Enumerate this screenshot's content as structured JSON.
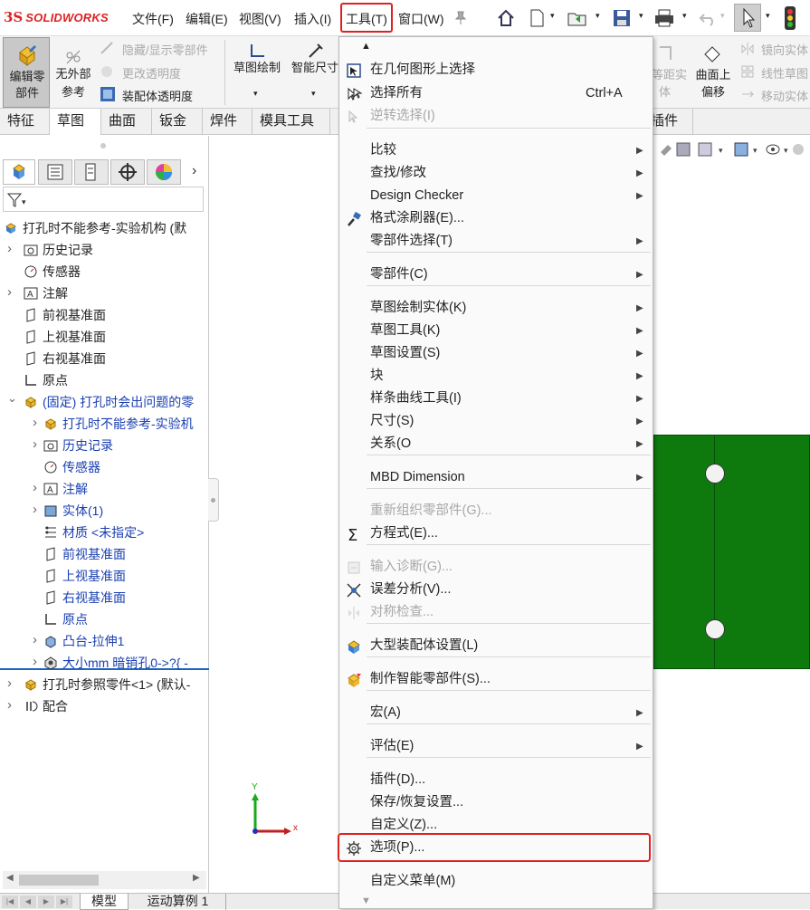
{
  "app": {
    "logo_prefix": "3S",
    "logo_name": "SOLIDWORKS"
  },
  "menubar": {
    "items": [
      "文件(F)",
      "编辑(E)",
      "视图(V)",
      "插入(I)",
      "工具(T)",
      "窗口(W)"
    ]
  },
  "ribbon": {
    "edit_component": "编辑零\n部件",
    "edit_component_l1": "编辑零",
    "edit_component_l2": "部件",
    "no_external_l1": "无外部",
    "no_external_l2": "参考",
    "hide_show": "隐藏/显示零部件",
    "change_transparency": "更改透明度",
    "assembly_transparency": "装配体透明度",
    "sketch": "草图绘制",
    "smart_dim": "智能尺寸",
    "equal_dist_l1": "等距实",
    "equal_dist_l2": "体",
    "offset_surface_l1": "曲面上",
    "offset_surface_l2": "偏移",
    "mirror_entity": "镜向实体",
    "linear_pattern": "线性草图",
    "move_entity": "移动实体"
  },
  "command_tabs": [
    "特征",
    "草图",
    "曲面",
    "钣金",
    "焊件",
    "模具工具",
    "插件"
  ],
  "feature_tree": {
    "filter_icon": "funnel-icon",
    "rows": [
      {
        "label": "打孔时不能参考-实验机构 (默",
        "level": 0,
        "arrow": false,
        "color": "normal"
      },
      {
        "label": "历史记录",
        "level": 1,
        "arrow": true,
        "color": "normal"
      },
      {
        "label": "传感器",
        "level": 1,
        "arrow": false,
        "color": "normal"
      },
      {
        "label": "注解",
        "level": 1,
        "arrow": true,
        "color": "normal"
      },
      {
        "label": "前视基准面",
        "level": 1,
        "arrow": false,
        "color": "normal"
      },
      {
        "label": "上视基准面",
        "level": 1,
        "arrow": false,
        "color": "normal"
      },
      {
        "label": "右视基准面",
        "level": 1,
        "arrow": false,
        "color": "normal"
      },
      {
        "label": "原点",
        "level": 1,
        "arrow": false,
        "color": "normal"
      },
      {
        "label": "(固定) 打孔时会出问题的零",
        "level": 1,
        "arrow": "open",
        "color": "blue"
      },
      {
        "label": "打孔时不能参考-实验机",
        "level": 2,
        "arrow": true,
        "color": "blue"
      },
      {
        "label": "历史记录",
        "level": 2,
        "arrow": true,
        "color": "blue"
      },
      {
        "label": "传感器",
        "level": 2,
        "arrow": false,
        "color": "blue"
      },
      {
        "label": "注解",
        "level": 2,
        "arrow": true,
        "color": "blue"
      },
      {
        "label": "实体(1)",
        "level": 2,
        "arrow": true,
        "color": "blue"
      },
      {
        "label": "材质 <未指定>",
        "level": 2,
        "arrow": false,
        "color": "blue"
      },
      {
        "label": "前视基准面",
        "level": 2,
        "arrow": false,
        "color": "blue"
      },
      {
        "label": "上视基准面",
        "level": 2,
        "arrow": false,
        "color": "blue"
      },
      {
        "label": "右视基准面",
        "level": 2,
        "arrow": false,
        "color": "blue"
      },
      {
        "label": "原点",
        "level": 2,
        "arrow": false,
        "color": "blue"
      },
      {
        "label": "凸台-拉伸1",
        "level": 2,
        "arrow": true,
        "color": "blue"
      },
      {
        "label": "大小mm 暗销孔0->?{ -",
        "level": 2,
        "arrow": true,
        "color": "blue"
      },
      {
        "label": "打孔时参照零件<1> (默认-",
        "level": 1,
        "arrow": true,
        "color": "normal"
      },
      {
        "label": "配合",
        "level": 1,
        "arrow": true,
        "color": "normal"
      }
    ]
  },
  "tools_menu": {
    "items": [
      {
        "label": "在几何图形上选择",
        "shortcut": "",
        "submenu": false,
        "disabled": false,
        "icon": "select-geometry-icon"
      },
      {
        "label": "选择所有",
        "shortcut": "Ctrl+A",
        "submenu": false,
        "disabled": false,
        "icon": "select-all-icon"
      },
      {
        "label": "逆转选择(I)",
        "shortcut": "",
        "submenu": false,
        "disabled": true,
        "icon": "invert-selection-icon"
      },
      {
        "label": "比较",
        "shortcut": "",
        "submenu": true,
        "disabled": false,
        "icon": ""
      },
      {
        "label": "查找/修改",
        "shortcut": "",
        "submenu": true,
        "disabled": false,
        "icon": ""
      },
      {
        "label": "Design Checker",
        "shortcut": "",
        "submenu": true,
        "disabled": false,
        "icon": ""
      },
      {
        "label": "格式涂刷器(E)...",
        "shortcut": "",
        "submenu": false,
        "disabled": false,
        "icon": "format-painter-icon"
      },
      {
        "label": "零部件选择(T)",
        "shortcut": "",
        "submenu": true,
        "disabled": false,
        "icon": ""
      },
      {
        "label": "零部件(C)",
        "shortcut": "",
        "submenu": true,
        "disabled": false,
        "icon": ""
      },
      {
        "label": "草图绘制实体(K)",
        "shortcut": "",
        "submenu": true,
        "disabled": false,
        "icon": ""
      },
      {
        "label": "草图工具(K)",
        "shortcut": "",
        "submenu": true,
        "disabled": false,
        "icon": ""
      },
      {
        "label": "草图设置(S)",
        "shortcut": "",
        "submenu": true,
        "disabled": false,
        "icon": ""
      },
      {
        "label": "块",
        "shortcut": "",
        "submenu": true,
        "disabled": false,
        "icon": ""
      },
      {
        "label": "样条曲线工具(I)",
        "shortcut": "",
        "submenu": true,
        "disabled": false,
        "icon": ""
      },
      {
        "label": "尺寸(S)",
        "shortcut": "",
        "submenu": true,
        "disabled": false,
        "icon": ""
      },
      {
        "label": "关系(O",
        "shortcut": "",
        "submenu": true,
        "disabled": false,
        "icon": ""
      },
      {
        "label": "MBD Dimension",
        "shortcut": "",
        "submenu": true,
        "disabled": false,
        "icon": ""
      },
      {
        "label": "重新组织零部件(G)...",
        "shortcut": "",
        "submenu": false,
        "disabled": true,
        "icon": ""
      },
      {
        "label": "方程式(E)...",
        "shortcut": "",
        "submenu": false,
        "disabled": false,
        "icon": "sigma-icon"
      },
      {
        "label": "输入诊断(G)...",
        "shortcut": "",
        "submenu": false,
        "disabled": true,
        "icon": "import-diagnostics-icon"
      },
      {
        "label": "误差分析(V)...",
        "shortcut": "",
        "submenu": false,
        "disabled": false,
        "icon": "deviation-analysis-icon"
      },
      {
        "label": "对称检查...",
        "shortcut": "",
        "submenu": false,
        "disabled": true,
        "icon": "symmetry-check-icon"
      },
      {
        "label": "大型装配体设置(L)",
        "shortcut": "",
        "submenu": false,
        "disabled": false,
        "icon": "large-assembly-icon"
      },
      {
        "label": "制作智能零部件(S)...",
        "shortcut": "",
        "submenu": false,
        "disabled": false,
        "icon": "smart-component-icon"
      },
      {
        "label": "宏(A)",
        "shortcut": "",
        "submenu": true,
        "disabled": false,
        "icon": ""
      },
      {
        "label": "评估(E)",
        "shortcut": "",
        "submenu": true,
        "disabled": false,
        "icon": ""
      },
      {
        "label": "插件(D)...",
        "shortcut": "",
        "submenu": false,
        "disabled": false,
        "icon": ""
      },
      {
        "label": "保存/恢复设置...",
        "shortcut": "",
        "submenu": false,
        "disabled": false,
        "icon": ""
      },
      {
        "label": "自定义(Z)...",
        "shortcut": "",
        "submenu": false,
        "disabled": false,
        "icon": ""
      },
      {
        "label": "选项(P)...",
        "shortcut": "",
        "submenu": false,
        "disabled": false,
        "icon": "gear-icon"
      },
      {
        "label": "自定义菜单(M)",
        "shortcut": "",
        "submenu": false,
        "disabled": false,
        "icon": ""
      }
    ]
  },
  "bottom_tabs": [
    "模型",
    "运动算例 1"
  ],
  "triad": {
    "x_label": "x",
    "y_label": "Y"
  },
  "colors": {
    "highlight_red": "#e02020",
    "part_green": "#0e7a0e",
    "tree_blue": "#1a3fb0"
  }
}
